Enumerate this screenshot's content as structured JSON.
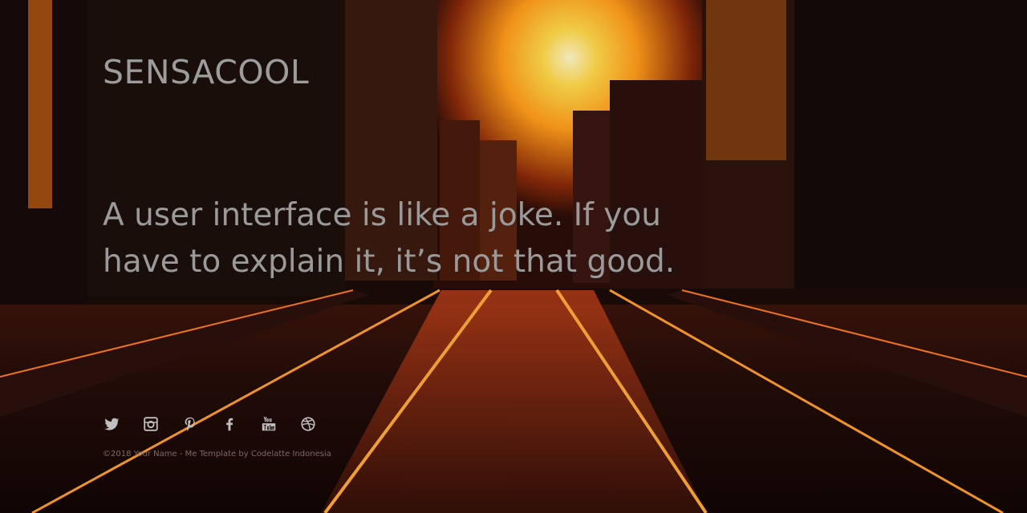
{
  "site": {
    "brand": "SENSACOOL"
  },
  "hero": {
    "quote": "A user interface is like a joke. If you have to explain it, it’s not that good."
  },
  "social": [
    {
      "icon": "twitter-icon"
    },
    {
      "icon": "instagram-icon"
    },
    {
      "icon": "pinterest-icon"
    },
    {
      "icon": "facebook-icon"
    },
    {
      "icon": "youtube-icon"
    },
    {
      "icon": "dribbble-icon"
    }
  ],
  "footer": {
    "copyright": "©2018 Your Name - Me Template by Codelatte Indonesia"
  },
  "colors": {
    "sky": "#ffd84a",
    "sunset": "#ff8a1a",
    "rail": "#ff9d2e",
    "text": "#9c9c9c"
  }
}
